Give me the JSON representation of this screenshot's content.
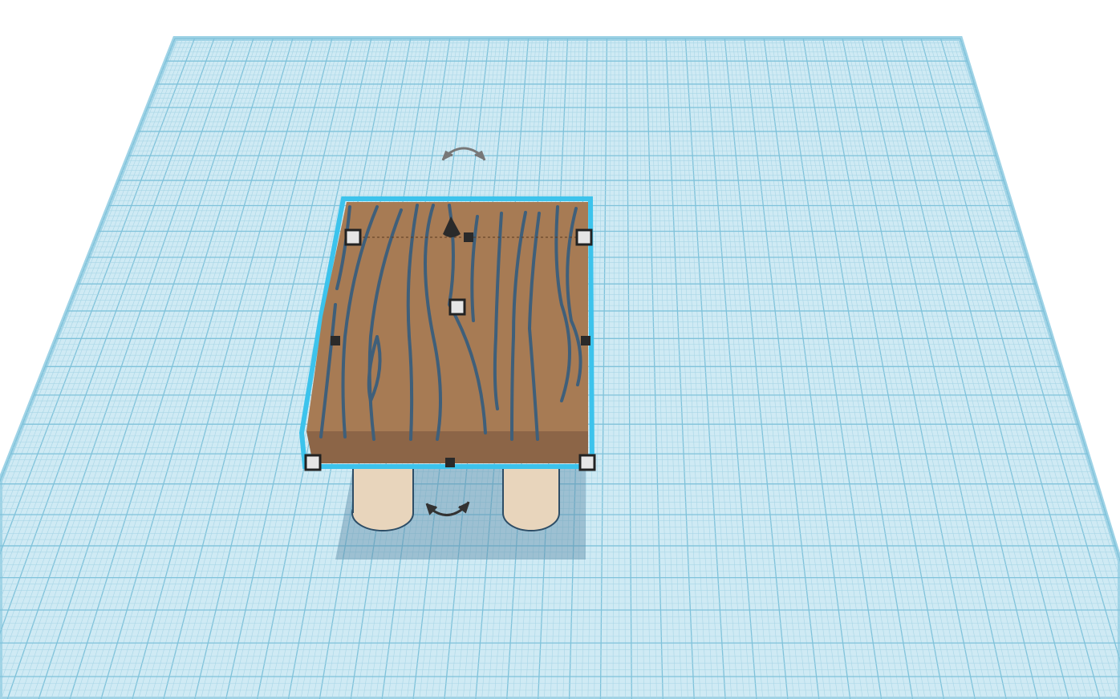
{
  "colors": {
    "background": "#ffffff",
    "workplane": "#cfeaf4",
    "grid_minor": "#a9d6e6",
    "grid_major": "#7fc2da",
    "selection_outline": "#3cc3ec",
    "wood_top": "#a77b54",
    "wood_side": "#8c6547",
    "wood_grain": "#3f5f7a",
    "leg": "#e8d5bc",
    "shadow": "#5f8fa8"
  },
  "icons": {
    "rotate_top": "rotate-arrow-icon",
    "rotate_bottom": "rotate-arrow-icon",
    "lift_cone": "lift-cone-icon"
  }
}
